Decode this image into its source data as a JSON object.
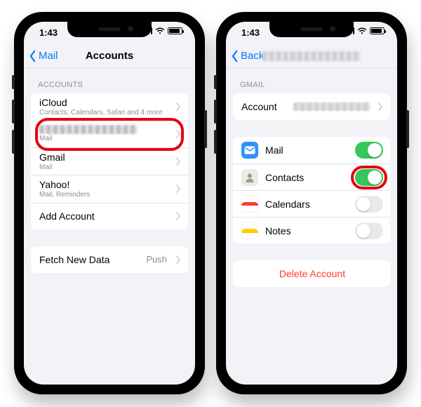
{
  "status": {
    "time": "1:43"
  },
  "left_phone": {
    "nav": {
      "back_label": "Mail",
      "title": "Accounts"
    },
    "section_accounts": "Accounts",
    "rows": {
      "icloud": {
        "label": "iCloud",
        "sub": "Contacts, Calendars, Safari and 4 more"
      },
      "highlighted": {
        "sub": "Mail"
      },
      "gmail": {
        "label": "Gmail",
        "sub": "Mail"
      },
      "yahoo": {
        "label": "Yahoo!",
        "sub": "Mail, Reminders"
      },
      "add": {
        "label": "Add Account"
      }
    },
    "fetch": {
      "label": "Fetch New Data",
      "value": "Push"
    }
  },
  "right_phone": {
    "nav": {
      "back_label": "Back"
    },
    "section_gmail": "Gmail",
    "account_row_label": "Account",
    "services": {
      "mail": {
        "label": "Mail",
        "on": true
      },
      "contacts": {
        "label": "Contacts",
        "on": true
      },
      "calendars": {
        "label": "Calendars",
        "on": false
      },
      "notes": {
        "label": "Notes",
        "on": false
      }
    },
    "delete_label": "Delete Account"
  }
}
